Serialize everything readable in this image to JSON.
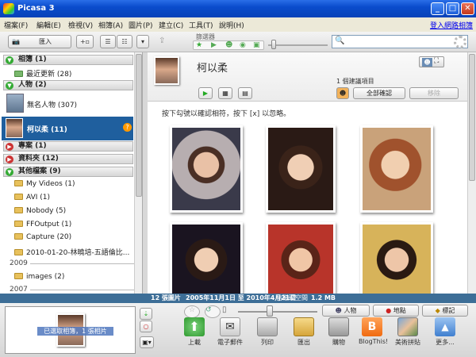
{
  "window": {
    "title": "Picasa 3"
  },
  "menu": {
    "items": [
      "檔案(F)",
      "編輯(E)",
      "檢視(V)",
      "相簿(A)",
      "圖片(P)",
      "建立(C)",
      "工具(T)",
      "說明(H)"
    ],
    "signin": "登入網路相簿"
  },
  "toolbar": {
    "import": "匯入",
    "slider_label": "篩選器"
  },
  "left": {
    "groups": [
      {
        "label": "相簿 (1)"
      },
      {
        "label": "人物 (2)"
      },
      {
        "label": "專案 (1)"
      },
      {
        "label": "資料夾 (12)"
      },
      {
        "label": "其他檔案 (9)"
      }
    ],
    "recent": "最近更新 (28)",
    "unnamed": "無名人物 (307)",
    "selected_person": "柯以柔 (11)",
    "folders": [
      "My Videos (1)",
      "AVI (1)",
      "Nobody (5)",
      "FFOutput (1)",
      "Capture (20)",
      "2010-01-20-林曉培-五語倫比..."
    ],
    "year1": "2009",
    "folder2009": "images (2)",
    "year2": "2007"
  },
  "main": {
    "person": "柯以柔",
    "suggest": "1 個建議項目",
    "confirm_all": "全部確認",
    "remove": "移除",
    "instruction": "按下勾號以確認相符，按下 [x] 以忽略。"
  },
  "status": {
    "count": "12 張圖片",
    "dates": "2005年11月1日 至 2010年4月21日",
    "disk_label": "佔磁碟空間",
    "size": "1.2 MB"
  },
  "bottom": {
    "tray_label": "已選取相簿，1 張相片",
    "people": "人物",
    "places": "地點",
    "tags": "標記",
    "actions": [
      "上載",
      "電子郵件",
      "列印",
      "匯出",
      "購物",
      "BlogThis!",
      "美術拼貼",
      "更多..."
    ]
  },
  "colors": {
    "titlebar": "#0a4ccc",
    "statusbar": "#3d6e97",
    "selected": "#1f5f9e"
  }
}
